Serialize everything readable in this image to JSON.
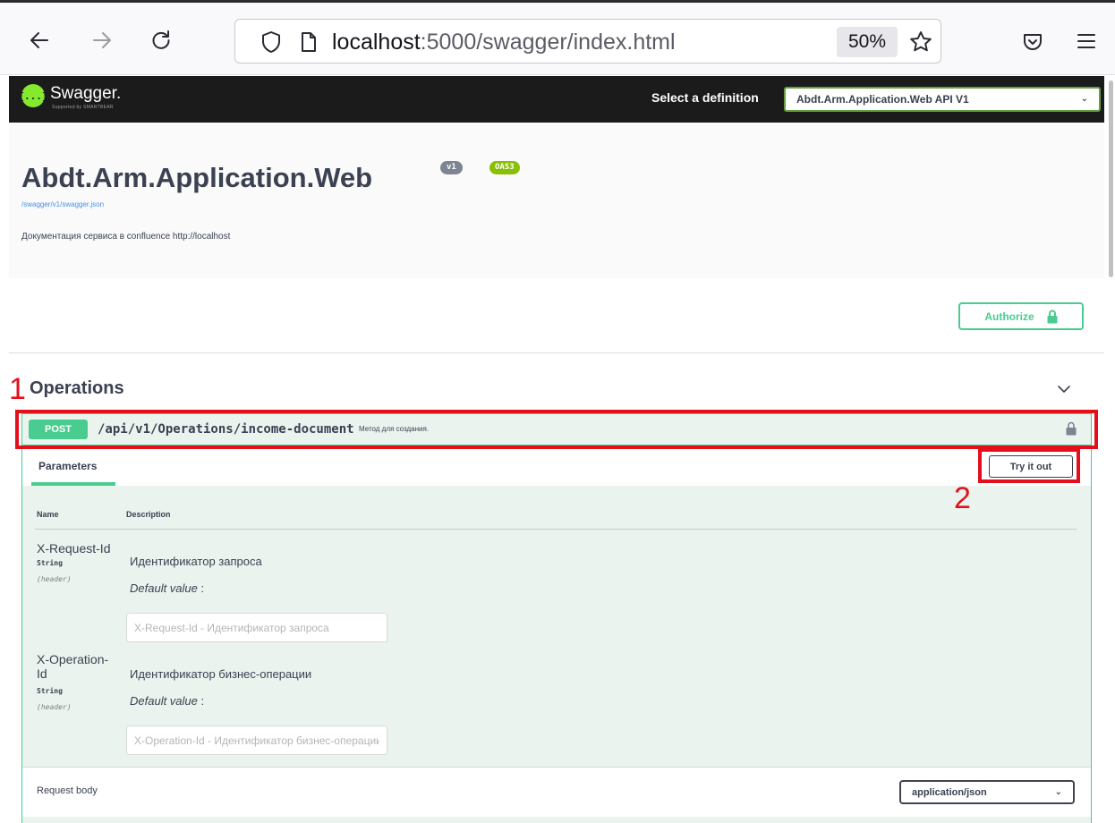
{
  "browser": {
    "url_host": "localhost",
    "url_rest": ":5000/swagger/index.html",
    "zoom": "50%"
  },
  "topbar": {
    "logo_mark": "{...}",
    "logo_text": "Swagger.",
    "logo_sub": "Supported by SMARTBEAR",
    "definition_label": "Select a definition",
    "definition_value": "Abdt.Arm.Application.Web API V1"
  },
  "info": {
    "title": "Abdt.Arm.Application.Web",
    "version_badge": "v1",
    "oas_badge": "OAS3",
    "json_link": "/swagger/v1/swagger.json",
    "description": "Документация сервиса в confluence http://localhost"
  },
  "authorize": {
    "label": "Authorize"
  },
  "annotations": {
    "one": "1",
    "two": "2"
  },
  "tag": {
    "title": "Operations"
  },
  "operation": {
    "method": "POST",
    "path": "/api/v1/Operations/income-document",
    "summary": "Метод для создания.",
    "parameters_tab": "Parameters",
    "try_button": "Try it out",
    "col_name": "Name",
    "col_description": "Description",
    "parameters": [
      {
        "name_line1": "X-Request-Id",
        "name_line2": "",
        "type": "String",
        "in": "(header)",
        "description": "Идентификатор запроса",
        "default_label": "Default value",
        "default_sep": " :",
        "placeholder": "X-Request-Id - Идентификатор запроса"
      },
      {
        "name_line1": "X-Operation-",
        "name_line2": "Id",
        "type": "String",
        "in": "(header)",
        "description": "Идентификатор бизнес-операции",
        "default_label": "Default value",
        "default_sep": " :",
        "placeholder": "X-Operation-Id - Идентификатор бизнес-операции"
      }
    ],
    "request_body_label": "Request body",
    "content_type": "application/json"
  },
  "colors": {
    "post_green": "#49cc90",
    "annotation_red": "#e3101c",
    "topbar_bg": "#1b1b1b",
    "link_blue": "#4990e2"
  }
}
